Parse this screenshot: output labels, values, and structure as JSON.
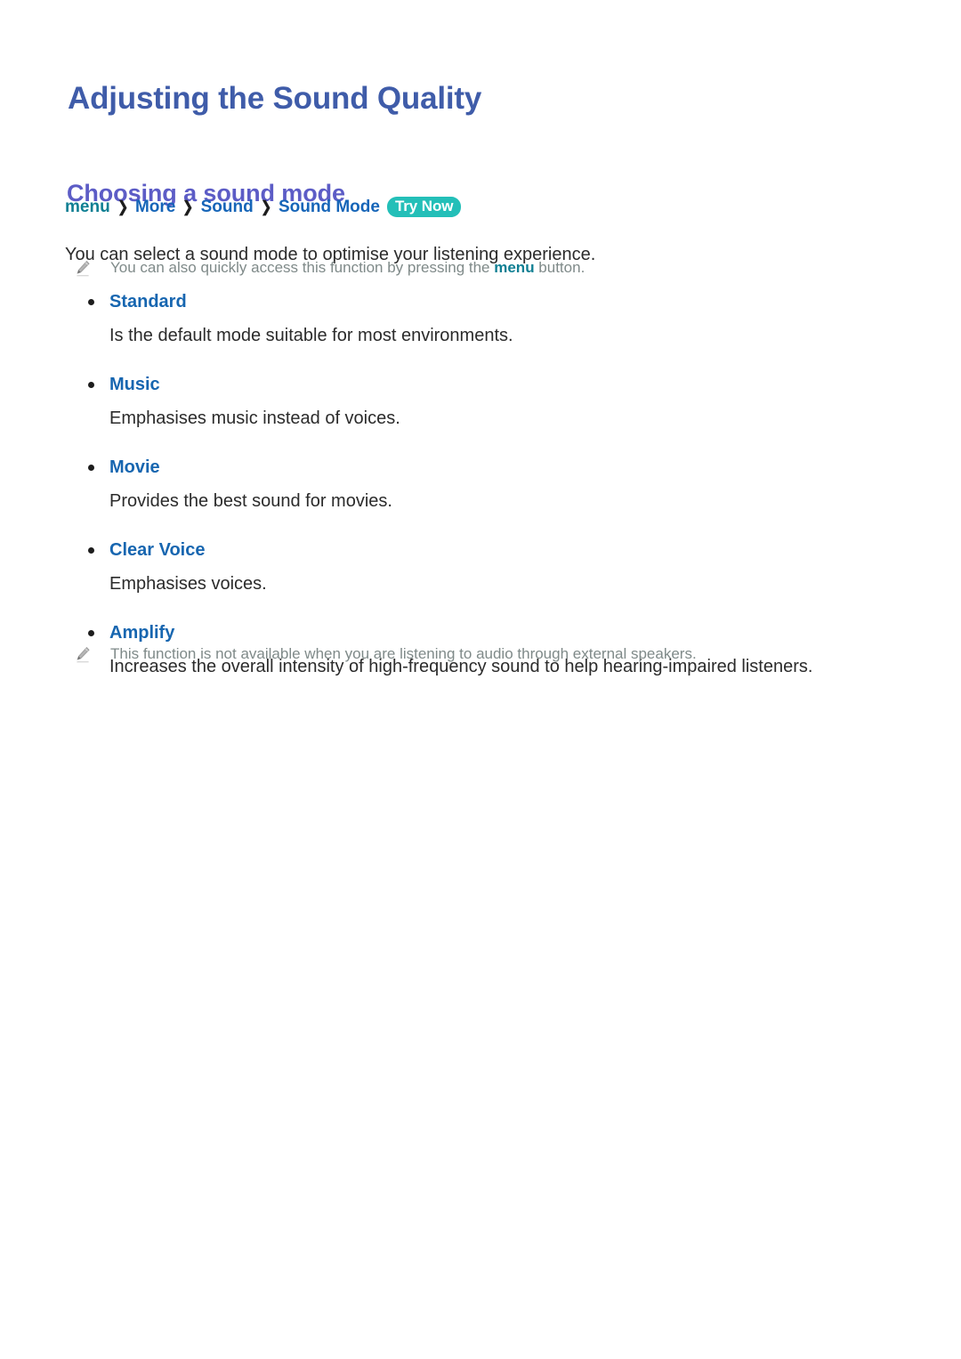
{
  "document": {
    "title": "Adjusting the Sound Quality",
    "section_heading": "Choosing a sound mode"
  },
  "breadcrumb": {
    "menu": "menu",
    "separator": "❯",
    "items": [
      "More",
      "Sound",
      "Sound Mode"
    ],
    "badge": "Try Now"
  },
  "intro": "You can select a sound mode to optimise your listening experience.",
  "notes": [
    {
      "icon": "pencil-icon",
      "before": "You can also quickly access this function by pressing the ",
      "keyword": "menu",
      "after": " button."
    },
    {
      "icon": "pencil-icon",
      "before": "This function is not available when you are listening to audio through external speakers.",
      "keyword": "",
      "after": ""
    }
  ],
  "modes": [
    {
      "term": "Standard",
      "description": "Is the default mode suitable for most environments."
    },
    {
      "term": "Music",
      "description": "Emphasises music instead of voices."
    },
    {
      "term": "Movie",
      "description": "Provides the best sound for movies."
    },
    {
      "term": "Clear Voice",
      "description": "Emphasises voices."
    },
    {
      "term": "Amplify",
      "description": "Increases the overall intensity of high-frequency sound to help hearing-impaired listeners."
    }
  ],
  "colors": {
    "title": "#3f5ca9",
    "section_heading": "#5c5cc6",
    "breadcrumb_menu": "#0f7f93",
    "breadcrumb_link": "#1665b8",
    "badge_bg": "#23bfb8",
    "badge_text": "#ffffff",
    "term": "#1766b0",
    "body": "#2b2b2b",
    "note": "#7f8a89",
    "page_bg": "#ffffff"
  }
}
